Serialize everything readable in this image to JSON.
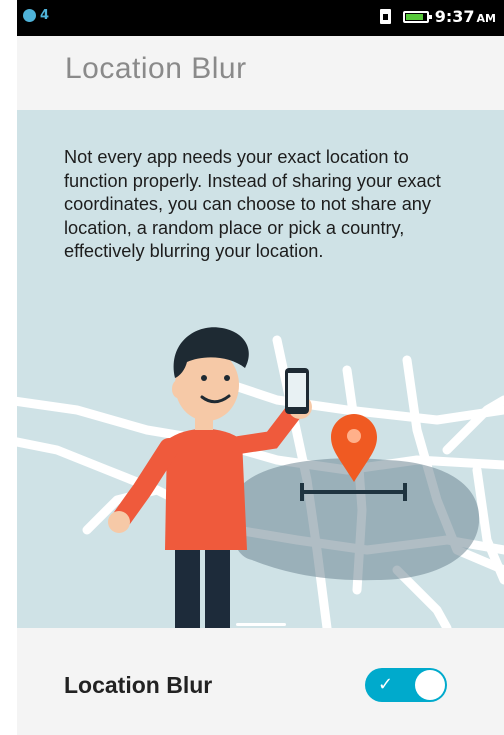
{
  "status_bar": {
    "notification_count": "4",
    "time": "9:37",
    "ampm": "AM",
    "battery_color": "#57c93b",
    "icons": [
      "notification-icon",
      "sim-icon",
      "battery-icon"
    ]
  },
  "header": {
    "title": "Location Blur"
  },
  "hero": {
    "description": "Not every app needs your exact location to function properly. Instead of sharing your exact coordinates, you can choose to not share any location, a random place or pick a country, effectively blurring your location.",
    "background_color": "#cfe2e6",
    "pin_color": "#f05a22"
  },
  "setting": {
    "label": "Location Blur",
    "enabled": true,
    "toggle_color": "#00aacc"
  }
}
